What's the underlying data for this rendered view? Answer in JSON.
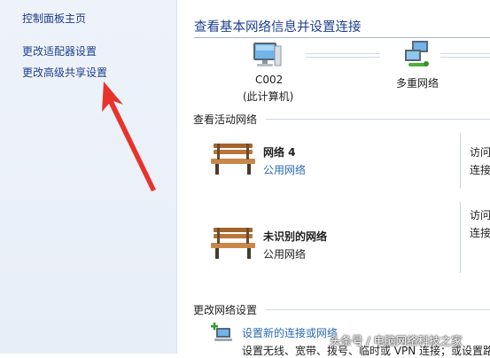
{
  "nav": {
    "home": "控制面板主页",
    "change_adapter": "更改适配器设置",
    "change_sharing": "更改高级共享设置"
  },
  "main": {
    "title": "查看基本网络信息并设置连接",
    "map": {
      "computer_name": "C002",
      "computer_sub": "(此计算机)",
      "network_label": "多重网络",
      "computer_icon": "computer-icon",
      "network_icon": "multiple-networks-icon"
    },
    "active_header": "查看活动网络",
    "networks": [
      {
        "name": "网络  4",
        "type": "公用网络",
        "access_1": "访问",
        "access_2": "连接",
        "icon": "park-bench-icon"
      },
      {
        "name": "未识别的网络",
        "type": "公用网络",
        "access_1": "访问",
        "access_2": "连接",
        "icon": "park-bench-icon"
      }
    ],
    "change_header": "更改网络设置",
    "settings": {
      "setup_link": "设置新的连接或网络",
      "setup_desc": "设置无线、宽带、拨号、临时或 VPN 连接；或设置路",
      "setup_icon": "new-connection-icon"
    }
  },
  "watermark": "头条号 / 电脑网络科技之家",
  "colors": {
    "link": "#2a6ab5",
    "title": "#1e3f8f",
    "arrow": "#e8332b",
    "nav_bg": "#eef3fa"
  }
}
